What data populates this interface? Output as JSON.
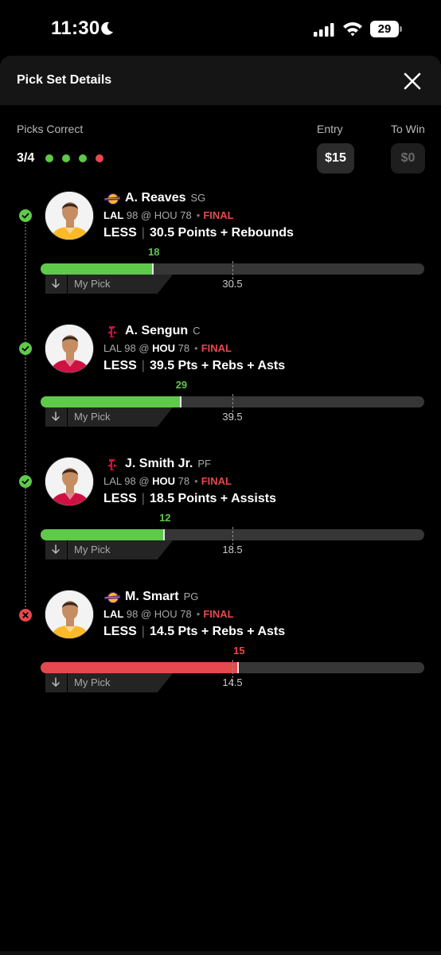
{
  "status_bar": {
    "time": "11:30",
    "battery": "29"
  },
  "header": {
    "title": "Pick Set Details"
  },
  "summary": {
    "picks_correct_label": "Picks Correct",
    "picks_correct_value": "3/4",
    "results": [
      "win",
      "win",
      "win",
      "loss"
    ],
    "entry_label": "Entry",
    "entry_value": "$15",
    "to_win_label": "To Win",
    "to_win_value": "$0"
  },
  "colors": {
    "win": "#5fc94a",
    "loss": "#e5484d",
    "final": "#e5484d"
  },
  "picks": [
    {
      "result": "win",
      "team": "lakers",
      "name": "A. Reaves",
      "position": "SG",
      "away_team": "LAL",
      "away_score": "98",
      "home_team": "HOU",
      "home_score": "78",
      "bold_team": "away",
      "status": "FINAL",
      "direction": "LESS",
      "line": "30.5",
      "stat": "Points + Rebounds",
      "actual": "18",
      "actual_num": 18,
      "line_num": 30.5,
      "my_pick_label": "My Pick"
    },
    {
      "result": "win",
      "team": "rockets",
      "name": "A. Sengun",
      "position": "C",
      "away_team": "LAL",
      "away_score": "98",
      "home_team": "HOU",
      "home_score": "78",
      "bold_team": "home",
      "status": "FINAL",
      "direction": "LESS",
      "line": "39.5",
      "stat": "Pts + Rebs + Asts",
      "actual": "29",
      "actual_num": 29,
      "line_num": 39.5,
      "my_pick_label": "My Pick"
    },
    {
      "result": "win",
      "team": "rockets",
      "name": "J. Smith Jr.",
      "position": "PF",
      "away_team": "LAL",
      "away_score": "98",
      "home_team": "HOU",
      "home_score": "78",
      "bold_team": "home",
      "status": "FINAL",
      "direction": "LESS",
      "line": "18.5",
      "stat": "Points + Assists",
      "actual": "12",
      "actual_num": 12,
      "line_num": 18.5,
      "my_pick_label": "My Pick"
    },
    {
      "result": "loss",
      "team": "lakers",
      "name": "M. Smart",
      "position": "PG",
      "away_team": "LAL",
      "away_score": "98",
      "home_team": "HOU",
      "home_score": "78",
      "bold_team": "away",
      "status": "FINAL",
      "direction": "LESS",
      "line": "14.5",
      "stat": "Pts + Rebs + Asts",
      "actual": "15",
      "actual_num": 15,
      "line_num": 14.5,
      "my_pick_label": "My Pick"
    }
  ]
}
